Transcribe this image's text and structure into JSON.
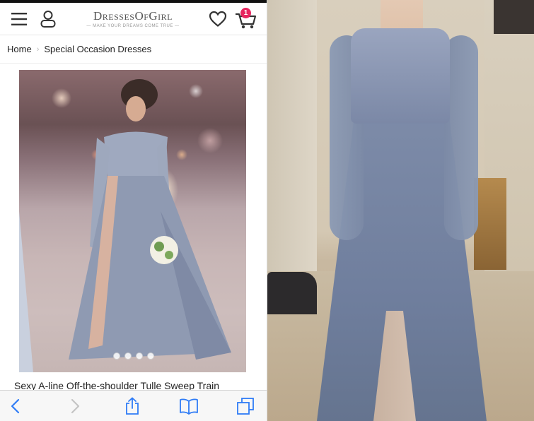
{
  "header": {
    "brand_name": "DressesOfGirl",
    "brand_tagline": "— MAKE YOUR DREAMS COME TRUE —",
    "cart_count": "1",
    "colors": {
      "badge": "#e8265f",
      "icon": "#333333"
    }
  },
  "breadcrumb": {
    "items": [
      {
        "label": "Home"
      },
      {
        "label": "Special Occasion Dresses"
      }
    ]
  },
  "product": {
    "title": "Sexy A-line Off-the-shoulder Tulle Sweep Train",
    "image_count": 4
  },
  "browser_toolbar": {
    "icons": [
      "back-icon",
      "forward-icon",
      "share-icon",
      "bookmarks-icon",
      "tabs-icon"
    ]
  }
}
